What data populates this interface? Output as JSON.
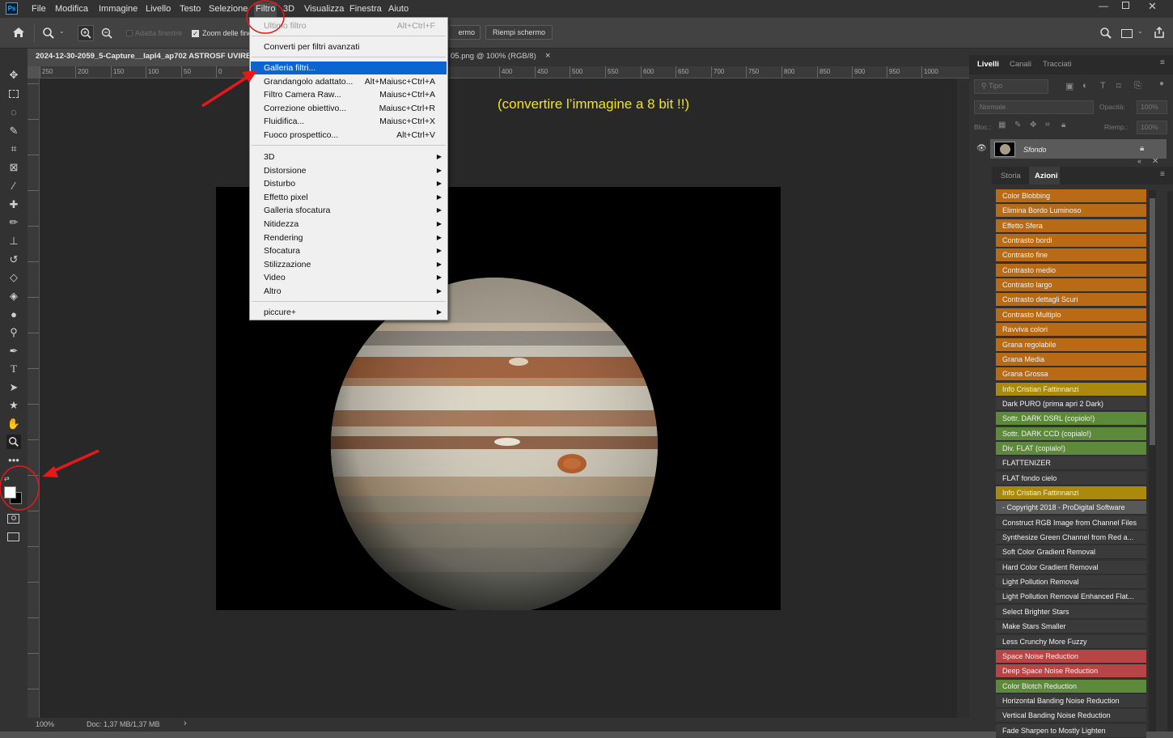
{
  "app": {
    "logo": "Ps"
  },
  "menubar": {
    "items": [
      "File",
      "Modifica",
      "Immagine",
      "Livello",
      "Testo",
      "Selezione",
      "Filtro",
      "3D",
      "Visualizza",
      "Finestra",
      "Aiuto"
    ]
  },
  "options": {
    "adapt": "Adatta finestre",
    "zoom_all": "Zoom delle fine",
    "fill_screen": "Riempi schermo",
    "screen_partial": "ermo"
  },
  "doc": {
    "tab1": "2024-12-30-2059_5-Capture__lapl4_ap702 ASTROSF UVIRBL",
    "tab2": "05.png @ 100% (RGB/8)",
    "close": "×"
  },
  "ruler": {
    "h": [
      "250",
      "200",
      "150",
      "100",
      "50",
      "0",
      "400",
      "450",
      "500",
      "550",
      "600",
      "650",
      "700",
      "750",
      "800",
      "850",
      "900",
      "950",
      "1000"
    ]
  },
  "canvas": {
    "annotation": "(convertire l’immagine a 8 bit !!)"
  },
  "status": {
    "zoom": "100%",
    "doc": "Doc: 1,37 MB/1,37 MB"
  },
  "filter_menu": {
    "last": {
      "label": "Ultimo filtro",
      "shortcut": "Alt+Ctrl+F"
    },
    "convert": "Converti per filtri avanzati",
    "top": [
      {
        "label": "Galleria filtri...",
        "shortcut": ""
      },
      {
        "label": "Grandangolo adattato...",
        "shortcut": "Alt+Maiusc+Ctrl+A"
      },
      {
        "label": "Filtro Camera Raw...",
        "shortcut": "Maiusc+Ctrl+A"
      },
      {
        "label": "Correzione obiettivo...",
        "shortcut": "Maiusc+Ctrl+R"
      },
      {
        "label": "Fluidifica...",
        "shortcut": "Maiusc+Ctrl+X"
      },
      {
        "label": "Fuoco prospettico...",
        "shortcut": "Alt+Ctrl+V"
      }
    ],
    "sub": [
      "3D",
      "Distorsione",
      "Disturbo",
      "Effetto pixel",
      "Galleria sfocatura",
      "Nitidezza",
      "Rendering",
      "Sfocatura",
      "Stilizzazione",
      "Video",
      "Altro"
    ],
    "plugin": "piccure+"
  },
  "panels": {
    "layer_tabs": [
      "Livelli",
      "Canali",
      "Tracciati"
    ],
    "kind": "Tipo",
    "blend": "Normale",
    "opacity_label": "Opacità:",
    "opacity": "100%",
    "lock_label": "Bloc.:",
    "fill_label": "Riemp.:",
    "fill": "100%",
    "layer_name": "Sfondo",
    "action_tabs": [
      "Storia",
      "Azioni"
    ]
  },
  "colors": {
    "orange": "#b86a14",
    "gold": "#a98a0d",
    "green": "#5d8a3a",
    "red": "#b84545",
    "gray": "#3a3a3a",
    "mid": "#585858",
    "highlight": "#0b64d0",
    "arrow": "#e81818"
  },
  "actions": [
    {
      "label": "Color Blobbing",
      "color": "orange"
    },
    {
      "label": "Elimina Bordo Luminoso",
      "color": "orange"
    },
    {
      "label": "Effetto Sfera",
      "color": "orange"
    },
    {
      "label": "Contrasto bordi",
      "color": "orange"
    },
    {
      "label": "Contrasto fine",
      "color": "orange"
    },
    {
      "label": "Contrasto medio",
      "color": "orange"
    },
    {
      "label": "Contrasto largo",
      "color": "orange"
    },
    {
      "label": "Contrasto dettagli Scuri",
      "color": "orange"
    },
    {
      "label": "Contrasto Multiplo",
      "color": "orange"
    },
    {
      "label": "Ravviva colori",
      "color": "orange"
    },
    {
      "label": "Grana regolabile",
      "color": "orange"
    },
    {
      "label": "Grana Media",
      "color": "orange"
    },
    {
      "label": "Grana Grossa",
      "color": "orange"
    },
    {
      "label": "Info Cristian Fattinnanzi",
      "color": "gold"
    },
    {
      "label": "Dark PURO (prima apri 2 Dark)",
      "color": "gray"
    },
    {
      "label": "Sottr. DARK DSRL (copiolo!)",
      "color": "green"
    },
    {
      "label": "Sottr. DARK CCD (copialo!)",
      "color": "green"
    },
    {
      "label": "Div. FLAT (copialo!)",
      "color": "green"
    },
    {
      "label": "FLATTENIZER",
      "color": "gray"
    },
    {
      "label": "FLAT fondo cielo",
      "color": "gray"
    },
    {
      "label": "Info Cristian Fattinnanzi",
      "color": "gold"
    },
    {
      "label": "- Copyright 2018 - ProDigital Software",
      "color": "mid"
    },
    {
      "label": "Construct RGB Image from Channel Files",
      "color": "gray"
    },
    {
      "label": "Synthesize Green Channel from Red a...",
      "color": "gray"
    },
    {
      "label": "Soft Color Gradient Removal",
      "color": "gray"
    },
    {
      "label": "Hard Color Gradient Removal",
      "color": "gray"
    },
    {
      "label": "Light Pollution Removal",
      "color": "gray"
    },
    {
      "label": "Light Pollution Removal Enhanced Flat...",
      "color": "gray"
    },
    {
      "label": "Select Brighter Stars",
      "color": "gray"
    },
    {
      "label": "Make Stars Smaller",
      "color": "gray"
    },
    {
      "label": "Less Crunchy More Fuzzy",
      "color": "gray"
    },
    {
      "label": "Space Noise Reduction",
      "color": "red"
    },
    {
      "label": "Deep Space Noise Reduction",
      "color": "red"
    },
    {
      "label": "Color Blotch Reduction",
      "color": "green"
    },
    {
      "label": "Horizontal Banding Noise Reduction",
      "color": "gray"
    },
    {
      "label": "Vertical Banding Noise Reduction",
      "color": "gray"
    },
    {
      "label": "Fade Sharpen to Mostly Lighten",
      "color": "gray"
    }
  ]
}
